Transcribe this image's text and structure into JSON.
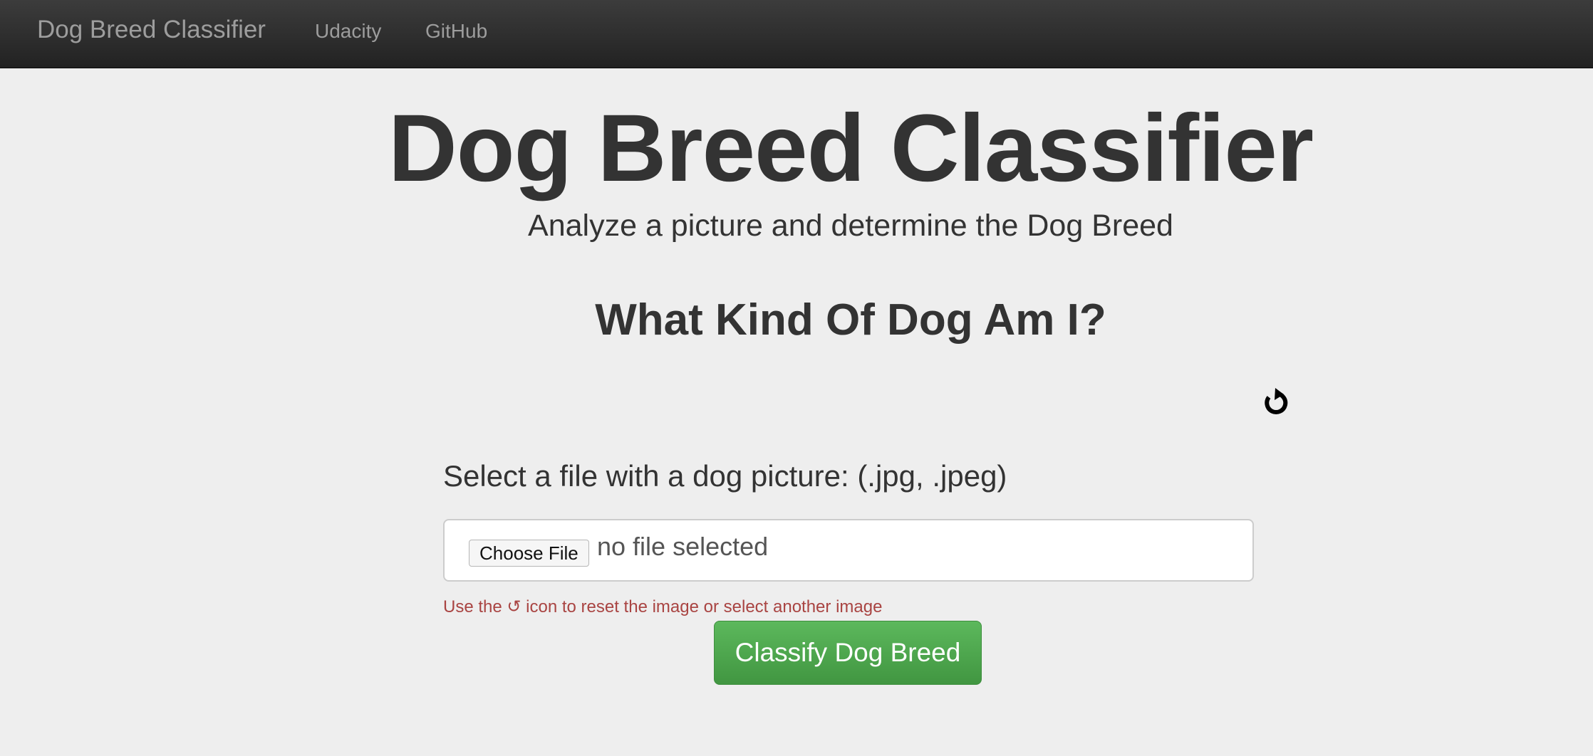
{
  "navbar": {
    "brand": "Dog Breed Classifier",
    "links": [
      {
        "label": "Udacity"
      },
      {
        "label": "GitHub"
      }
    ]
  },
  "header": {
    "title": "Dog Breed Classifier",
    "subtitle": "Analyze a picture and determine the Dog Breed"
  },
  "main": {
    "question": "What Kind Of Dog Am I?",
    "reset_icon": "reset-icon",
    "select_label": "Select a file with a dog picture: (.jpg, .jpeg)",
    "file_input": {
      "button_label": "Choose File",
      "status": "no file selected"
    },
    "help_text": "Use the ↺ icon to reset the image or select another image",
    "classify_button": "Classify Dog Breed"
  },
  "colors": {
    "background": "#eeeeee",
    "navbar": "#222222",
    "nav_text": "#9d9d9d",
    "help_text": "#a94442",
    "success_button": "#5cb85c"
  }
}
